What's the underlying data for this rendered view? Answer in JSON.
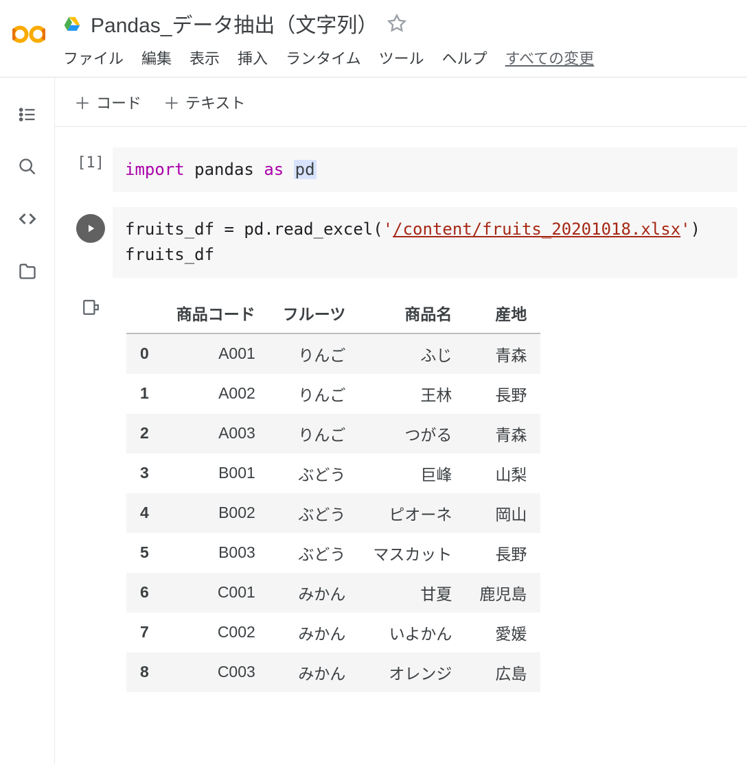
{
  "header": {
    "doc_title": "Pandas_データ抽出（文字列）"
  },
  "menubar": {
    "file": "ファイル",
    "edit": "編集",
    "view": "表示",
    "insert": "挿入",
    "runtime": "ランタイム",
    "tools": "ツール",
    "help": "ヘルプ",
    "save_status": "すべての変更"
  },
  "toolbar": {
    "code": "コード",
    "text": "テキスト"
  },
  "cells": {
    "cell1": {
      "exec_count": "[1]",
      "kw_import": "import",
      "mod": "pandas",
      "kw_as": "as",
      "alias": "pd"
    },
    "cell2": {
      "line1_pre": "fruits_df = pd.read_excel(",
      "line1_str_q1": "'",
      "line1_str_body": "/content/fruits_20201018.xlsx",
      "line1_str_q2": "'",
      "line1_post": ")",
      "line2": "fruits_df"
    }
  },
  "table": {
    "columns": [
      "商品コード",
      "フルーツ",
      "商品名",
      "産地"
    ],
    "rows": [
      {
        "idx": "0",
        "c0": "A001",
        "c1": "りんご",
        "c2": "ふじ",
        "c3": "青森"
      },
      {
        "idx": "1",
        "c0": "A002",
        "c1": "りんご",
        "c2": "王林",
        "c3": "長野"
      },
      {
        "idx": "2",
        "c0": "A003",
        "c1": "りんご",
        "c2": "つがる",
        "c3": "青森"
      },
      {
        "idx": "3",
        "c0": "B001",
        "c1": "ぶどう",
        "c2": "巨峰",
        "c3": "山梨"
      },
      {
        "idx": "4",
        "c0": "B002",
        "c1": "ぶどう",
        "c2": "ピオーネ",
        "c3": "岡山"
      },
      {
        "idx": "5",
        "c0": "B003",
        "c1": "ぶどう",
        "c2": "マスカット",
        "c3": "長野"
      },
      {
        "idx": "6",
        "c0": "C001",
        "c1": "みかん",
        "c2": "甘夏",
        "c3": "鹿児島"
      },
      {
        "idx": "7",
        "c0": "C002",
        "c1": "みかん",
        "c2": "いよかん",
        "c3": "愛媛"
      },
      {
        "idx": "8",
        "c0": "C003",
        "c1": "みかん",
        "c2": "オレンジ",
        "c3": "広島"
      }
    ]
  }
}
